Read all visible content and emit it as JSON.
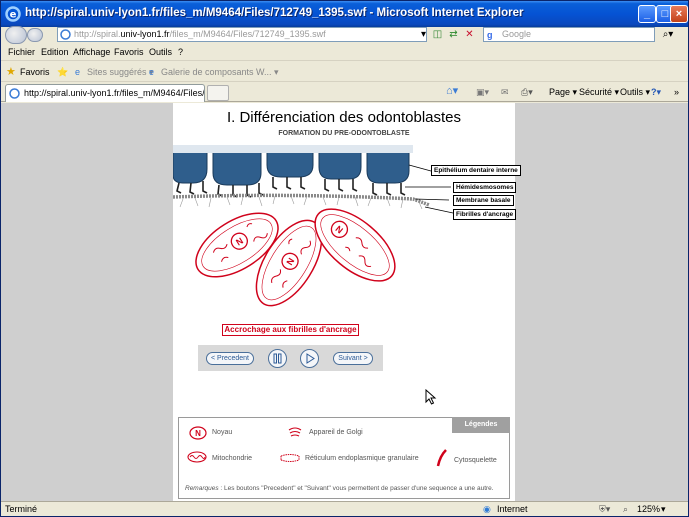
{
  "window": {
    "title": "http://spiral.univ-lyon1.fr/files_m/M9464/Files/712749_1395.swf - Microsoft Internet Explorer"
  },
  "address": {
    "url_prefix": "http://spiral.",
    "url_domain": "univ-lyon1.fr",
    "url_path": "/files_m/M9464/Files/712749_1395.swf",
    "search_placeholder": "Google"
  },
  "menu": {
    "items": [
      "Fichier",
      "Edition",
      "Affichage",
      "Favoris",
      "Outils",
      "?"
    ]
  },
  "favorites": {
    "label": "Favoris",
    "suggested": "Sites suggérés ▾",
    "gallery": "Galerie de composants W... ▾"
  },
  "tab": {
    "label": "http://spiral.univ-lyon1.fr/files_m/M9464/Files/71274..."
  },
  "commandbar": {
    "page": "Page ▾",
    "security": "Sécurité ▾",
    "tools": "Outils ▾"
  },
  "slide": {
    "title": "I. Différenciation des odontoblastes",
    "subtitle": "FORMATION DU PRE-ODONTOBLASTE",
    "labels": {
      "epithelium": "Epithélium dentaire interne",
      "hemidesmosomes": "Hémidesmosomes",
      "membrane": "Membrane basale",
      "fibrilles": "Fibrilles d'ancrage"
    },
    "nucleus_letter": "N",
    "caption": "Accrochage aux fibrilles d'ancrage",
    "controls": {
      "previous": "< Precedent",
      "next": "Suivant >"
    }
  },
  "legend": {
    "title": "Légendes",
    "items": {
      "noyau": "Noyau",
      "golgi": "Appareil de Golgi",
      "mito": "Mitochondrie",
      "reticulum": "Réticulum endoplasmique granulaire",
      "cyto": "Cytosquelette"
    },
    "remark_label": "Remarques",
    "remark_text": " : Les boutons \"Precedent\" et \"Suivant\" vous permettent de passer d'une sequence a une autre."
  },
  "status": {
    "left": "Terminé",
    "zone": "Internet",
    "zoom": "125%"
  },
  "colors": {
    "cell_red": "#d0021b",
    "epithelium_blue": "#2f5e8c"
  }
}
